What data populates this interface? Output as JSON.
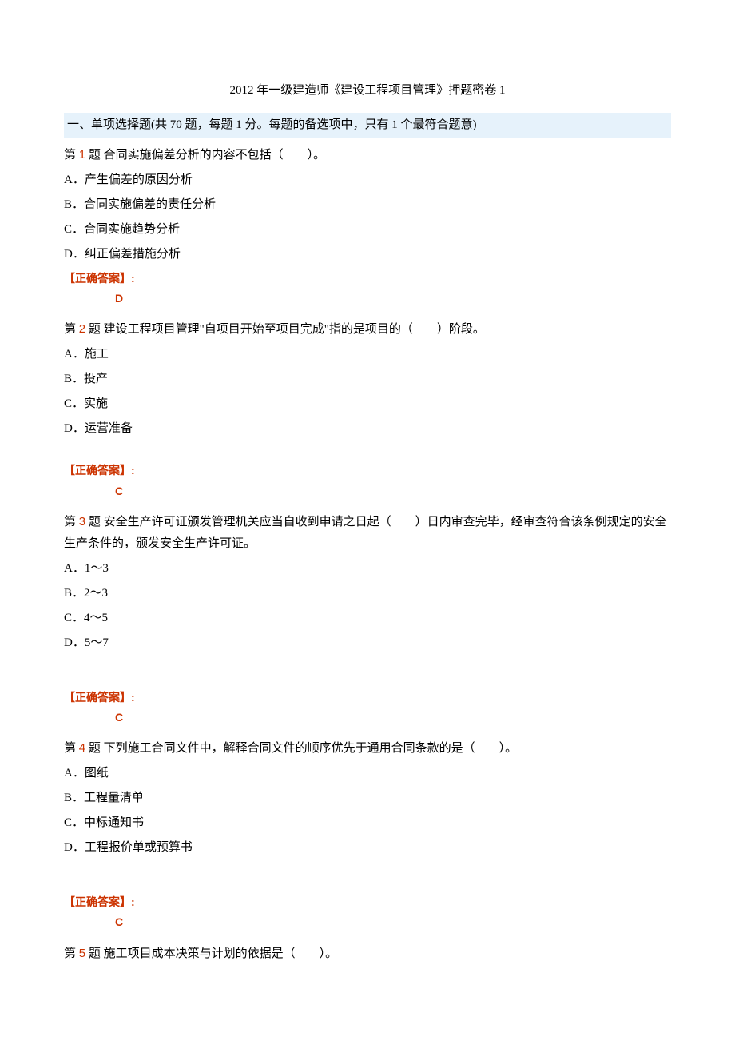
{
  "title": "2012 年一级建造师《建设工程项目管理》押题密卷 1",
  "section_header": "一、单项选择题(共 70 题，每题 1 分。每题的备选项中，只有 1 个最符合题意)",
  "q_prefix": "第 ",
  "q_suffix": " 题",
  "answer_label": "【正确答案】:",
  "questions": [
    {
      "num": "1",
      "text": "  合同实施偏差分析的内容不包括（　　）。",
      "options": [
        "A．产生偏差的原因分析",
        "B．合同实施偏差的责任分析",
        "C．合同实施趋势分析",
        "D．纠正偏差措施分析"
      ],
      "answer": "D",
      "gap_before_answer": false
    },
    {
      "num": "2",
      "text": "  建设工程项目管理\"自项目开始至项目完成\"指的是项目的（　　）阶段。",
      "options": [
        "A．施工",
        "B．投产",
        "C．实施",
        "D．运营准备"
      ],
      "answer": "C",
      "gap_before_answer": true
    },
    {
      "num": "3",
      "text": "  安全生产许可证颁发管理机关应当自收到申请之日起（　　）日内审查完毕，经审查符合该条例规定的安全生产条件的，颁发安全生产许可证。",
      "options": [
        "A．1～3",
        "B．2～3",
        "C．4～5",
        "D．5～7"
      ],
      "answer": "C",
      "gap_before_answer": true,
      "extra_gap": true
    },
    {
      "num": "4",
      "text": "  下列施工合同文件中，解释合同文件的顺序优先于通用合同条款的是（　　）。",
      "options": [
        "A．图纸",
        "B．工程量清单",
        "C．中标通知书",
        "D．工程报价单或预算书"
      ],
      "answer": "C",
      "gap_before_answer": true,
      "extra_gap": true
    },
    {
      "num": "5",
      "text": "  施工项目成本决策与计划的依据是（　　）。",
      "options": [],
      "answer": null
    }
  ]
}
